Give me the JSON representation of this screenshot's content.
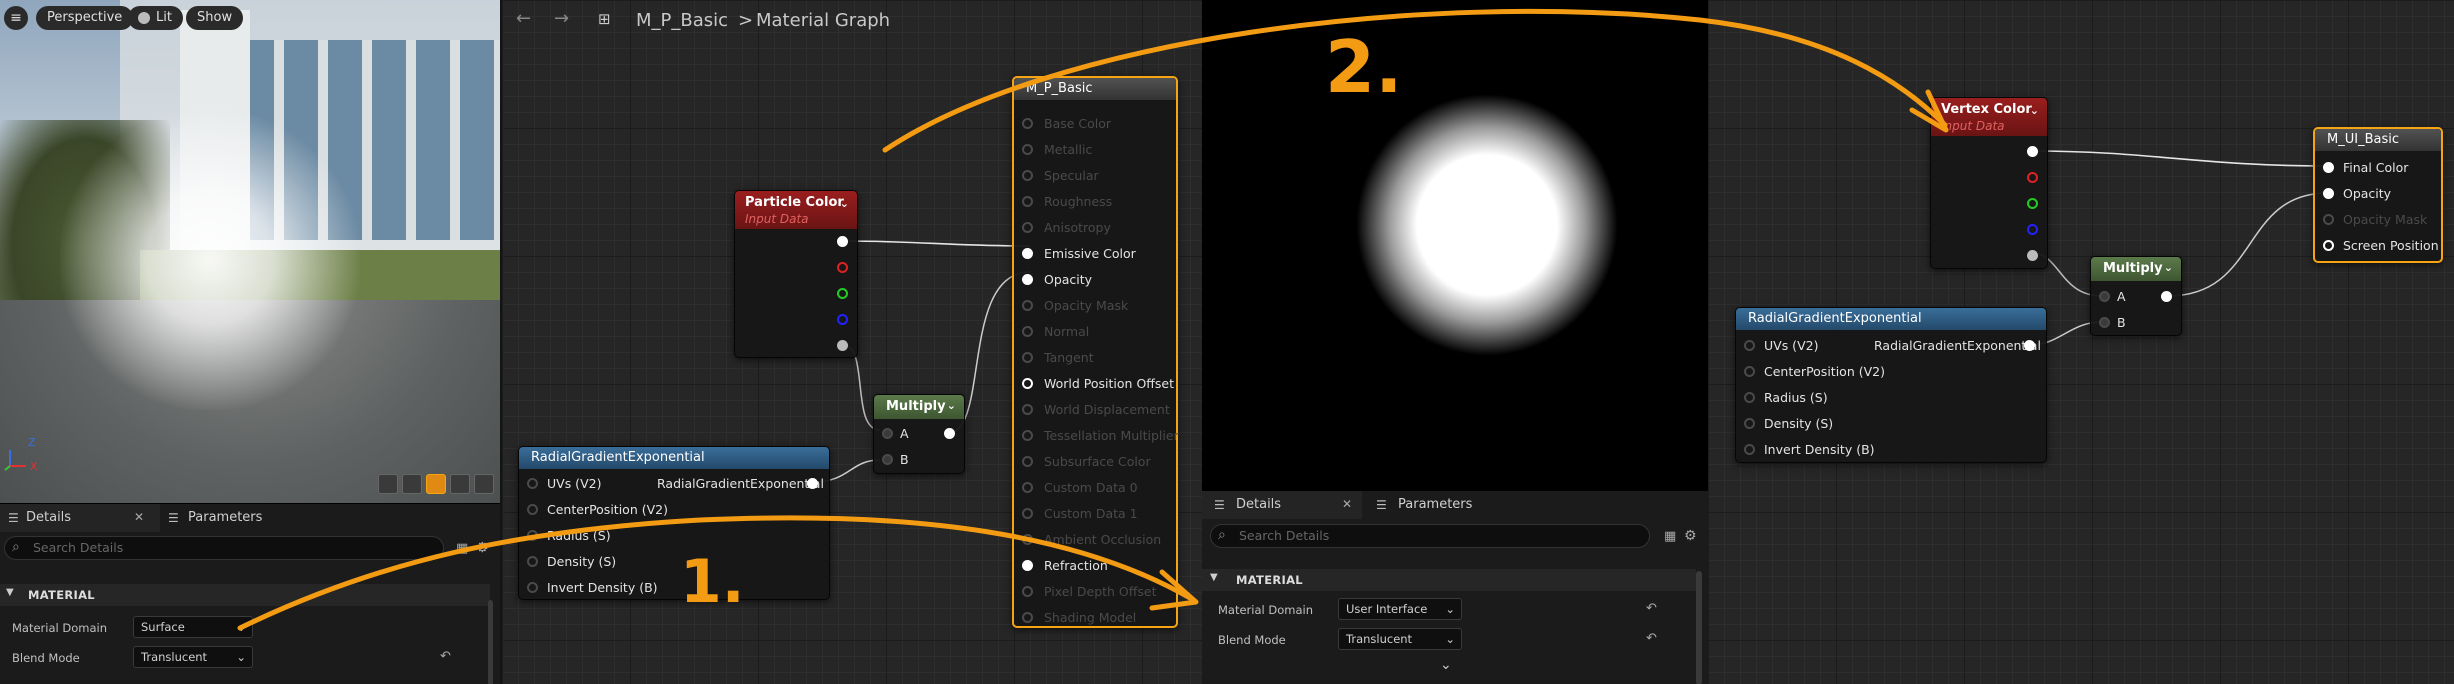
{
  "viewport": {
    "perspective": "Perspective",
    "lit": "Lit",
    "show": "Show",
    "axis_z": "Z",
    "axis_x": "X"
  },
  "left_details": {
    "tab_details": "Details",
    "tab_parameters": "Parameters",
    "search_placeholder": "Search Details",
    "section": "MATERIAL",
    "domain_label": "Material Domain",
    "domain_value": "Surface",
    "blend_label": "Blend Mode",
    "blend_value": "Translucent"
  },
  "graph_header": {
    "asset": "M_P_Basic",
    "separator": ">",
    "graph": "Material Graph"
  },
  "particle_color": {
    "title": "Particle Color",
    "subtitle": "Input Data"
  },
  "multiply1": {
    "title": "Multiply",
    "a": "A",
    "b": "B"
  },
  "radial1": {
    "title": "RadialGradientExponential",
    "output": "RadialGradientExponential",
    "inputs": [
      "UVs (V2)",
      "CenterPosition (V2)",
      "Radius (S)",
      "Density (S)",
      "Invert Density (B)"
    ]
  },
  "m_p_basic": {
    "title": "M_P_Basic",
    "pins": [
      "Base Color",
      "Metallic",
      "Specular",
      "Roughness",
      "Anisotropy",
      "Emissive Color",
      "Opacity",
      "Opacity Mask",
      "Normal",
      "Tangent",
      "World Position Offset",
      "World Displacement",
      "Tessellation Multiplier",
      "Subsurface Color",
      "Custom Data 0",
      "Custom Data 1",
      "Ambient Occlusion",
      "Refraction",
      "Pixel Depth Offset",
      "Shading Model"
    ]
  },
  "mid_details": {
    "tab_details": "Details",
    "tab_parameters": "Parameters",
    "search_placeholder": "Search Details",
    "section": "MATERIAL",
    "domain_label": "Material Domain",
    "domain_value": "User Interface",
    "blend_label": "Blend Mode",
    "blend_value": "Translucent"
  },
  "vertex_color": {
    "title": "Vertex Color",
    "subtitle": "Input Data"
  },
  "multiply2": {
    "title": "Multiply",
    "a": "A",
    "b": "B"
  },
  "radial2": {
    "title": "RadialGradientExponential",
    "output": "RadialGradientExponential",
    "inputs": [
      "UVs (V2)",
      "CenterPosition (V2)",
      "Radius (S)",
      "Density (S)",
      "Invert Density (B)"
    ]
  },
  "m_ui_basic": {
    "title": "M_UI_Basic",
    "pins": [
      "Final Color",
      "Opacity",
      "Opacity Mask",
      "Screen Position"
    ]
  },
  "annotations": {
    "step1": "1.",
    "step2": "2."
  },
  "colors": {
    "accent": "#f39b13",
    "selection": "#f5a514",
    "input_header": "#8c1c1c",
    "math_header": "#4c6a3c",
    "func_header": "#2e5a80",
    "result_header": "#3c3c3c"
  }
}
